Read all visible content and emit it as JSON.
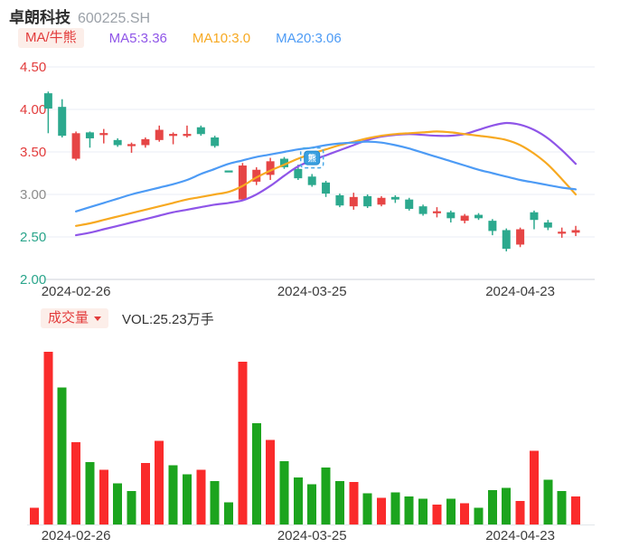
{
  "header": {
    "title": "卓朗科技",
    "code": "600225.SH"
  },
  "legend": {
    "toggle": "MA/牛熊",
    "ma5": "MA5:3.36",
    "ma10": "MA10:3.0",
    "ma20": "MA20:3.06"
  },
  "volume_header": {
    "selector": "成交量",
    "value": "VOL:25.23万手"
  },
  "colors": {
    "up": "#e64545",
    "down": "#2ca98e",
    "vol_up": "#fa2b2b",
    "vol_down": "#1ca41e",
    "ma5": "#8f55e8",
    "ma10": "#f7a921",
    "ma20": "#4d9bf5",
    "accent_red": "#e23b3b",
    "axis_label": "#3b3b3b",
    "grid": "#e9eef4",
    "axis_line": "#ccd2d9",
    "marker_fill": "#3ba0e0",
    "marker_border": "#2288cc",
    "marker_dash": "#4aa9e8"
  },
  "chart_data": [
    {
      "type": "candlestick",
      "title": "卓朗科技 600225.SH 日K",
      "y_ticks": [
        {
          "label": "4.50",
          "value": 4.5,
          "color": "#e23b3b"
        },
        {
          "label": "4.00",
          "value": 4.0,
          "color": "#e23b3b"
        },
        {
          "label": "3.50",
          "value": 3.5,
          "color": "#e23b3b"
        },
        {
          "label": "3.00",
          "value": 3.0,
          "color": "#8c8c8c"
        },
        {
          "label": "2.50",
          "value": 2.5,
          "color": "#2aa58b"
        },
        {
          "label": "2.00",
          "value": 2.0,
          "color": "#2aa58b"
        }
      ],
      "x_ticks": [
        {
          "day": 3,
          "label": "2024-02-26"
        },
        {
          "day": 20,
          "label": "2024-03-25"
        },
        {
          "day": 35,
          "label": "2024-04-23"
        }
      ],
      "ylim": [
        1.95,
        4.6
      ],
      "candles_note": "each entry: [day, open, close, high, low, dir(u=red up, d=green down)]",
      "candles": [
        [
          1,
          4.19,
          4.01,
          4.21,
          3.72,
          "d"
        ],
        [
          2,
          4.03,
          3.69,
          4.12,
          3.67,
          "d"
        ],
        [
          3,
          3.42,
          3.72,
          3.74,
          3.4,
          "u"
        ],
        [
          4,
          3.73,
          3.66,
          3.74,
          3.55,
          "d"
        ],
        [
          5,
          3.7,
          3.72,
          3.77,
          3.6,
          "u"
        ],
        [
          6,
          3.64,
          3.58,
          3.66,
          3.56,
          "d"
        ],
        [
          7,
          3.57,
          3.59,
          3.61,
          3.49,
          "u"
        ],
        [
          8,
          3.58,
          3.65,
          3.67,
          3.55,
          "u"
        ],
        [
          9,
          3.64,
          3.76,
          3.81,
          3.62,
          "u"
        ],
        [
          10,
          3.69,
          3.71,
          3.73,
          3.59,
          "u"
        ],
        [
          11,
          3.69,
          3.71,
          3.81,
          3.67,
          "u"
        ],
        [
          12,
          3.79,
          3.71,
          3.81,
          3.69,
          "d"
        ],
        [
          13,
          3.67,
          3.57,
          3.69,
          3.55,
          "d"
        ],
        [
          14,
          3.27,
          3.27,
          3.27,
          3.27,
          "d"
        ],
        [
          15,
          2.94,
          3.34,
          3.37,
          2.93,
          "u"
        ],
        [
          16,
          3.15,
          3.29,
          3.32,
          3.11,
          "u"
        ],
        [
          17,
          3.23,
          3.39,
          3.43,
          3.17,
          "u"
        ],
        [
          18,
          3.42,
          3.32,
          3.44,
          3.3,
          "d"
        ],
        [
          19,
          3.3,
          3.19,
          3.35,
          3.17,
          "d"
        ],
        [
          20,
          3.21,
          3.11,
          3.24,
          3.09,
          "d"
        ],
        [
          21,
          3.14,
          3.01,
          3.16,
          2.97,
          "d"
        ],
        [
          22,
          2.99,
          2.87,
          3.01,
          2.85,
          "d"
        ],
        [
          23,
          2.86,
          2.97,
          3.02,
          2.82,
          "u"
        ],
        [
          24,
          2.98,
          2.86,
          3.0,
          2.84,
          "d"
        ],
        [
          25,
          2.88,
          2.96,
          2.98,
          2.86,
          "u"
        ],
        [
          26,
          2.97,
          2.94,
          2.99,
          2.9,
          "d"
        ],
        [
          27,
          2.94,
          2.83,
          2.96,
          2.81,
          "d"
        ],
        [
          28,
          2.86,
          2.77,
          2.88,
          2.75,
          "d"
        ],
        [
          29,
          2.78,
          2.8,
          2.85,
          2.73,
          "u"
        ],
        [
          30,
          2.79,
          2.72,
          2.81,
          2.67,
          "d"
        ],
        [
          31,
          2.69,
          2.75,
          2.77,
          2.66,
          "u"
        ],
        [
          32,
          2.76,
          2.72,
          2.78,
          2.7,
          "d"
        ],
        [
          33,
          2.69,
          2.57,
          2.71,
          2.52,
          "d"
        ],
        [
          34,
          2.58,
          2.36,
          2.6,
          2.33,
          "d"
        ],
        [
          35,
          2.41,
          2.59,
          2.61,
          2.38,
          "u"
        ],
        [
          36,
          2.79,
          2.7,
          2.81,
          2.59,
          "d"
        ],
        [
          37,
          2.67,
          2.61,
          2.7,
          2.58,
          "d"
        ],
        [
          38,
          2.54,
          2.56,
          2.61,
          2.49,
          "u"
        ],
        [
          39,
          2.55,
          2.58,
          2.63,
          2.51,
          "u"
        ]
      ],
      "series": [
        {
          "name": "MA5",
          "color_key": "ma5",
          "latest": 3.36,
          "start_day": 3,
          "values": [
            2.52,
            2.55,
            2.59,
            2.63,
            2.67,
            2.71,
            2.75,
            2.79,
            2.82,
            2.85,
            2.88,
            2.9,
            2.93,
            3.0,
            3.1,
            3.22,
            3.33,
            3.4,
            3.46,
            3.52,
            3.58,
            3.64,
            3.68,
            3.7,
            3.71,
            3.7,
            3.69,
            3.69,
            3.71,
            3.76,
            3.81,
            3.84,
            3.82,
            3.76,
            3.66,
            3.52,
            3.36
          ]
        },
        {
          "name": "MA10",
          "color_key": "ma10",
          "latest": 3.0,
          "start_day": 3,
          "values": [
            2.63,
            2.66,
            2.7,
            2.74,
            2.78,
            2.82,
            2.86,
            2.9,
            2.94,
            2.97,
            3.0,
            3.03,
            3.1,
            3.2,
            3.28,
            3.35,
            3.42,
            3.48,
            3.53,
            3.58,
            3.62,
            3.66,
            3.69,
            3.71,
            3.72,
            3.73,
            3.74,
            3.73,
            3.71,
            3.69,
            3.67,
            3.64,
            3.58,
            3.48,
            3.35,
            3.18,
            3.0
          ]
        },
        {
          "name": "MA20",
          "color_key": "ma20",
          "latest": 3.06,
          "start_day": 3,
          "values": [
            2.8,
            2.85,
            2.9,
            2.95,
            3.0,
            3.04,
            3.08,
            3.12,
            3.17,
            3.24,
            3.3,
            3.36,
            3.4,
            3.44,
            3.47,
            3.5,
            3.53,
            3.55,
            3.58,
            3.6,
            3.61,
            3.62,
            3.61,
            3.58,
            3.54,
            3.49,
            3.44,
            3.39,
            3.34,
            3.29,
            3.25,
            3.21,
            3.17,
            3.14,
            3.11,
            3.08,
            3.06
          ]
        }
      ],
      "marker": {
        "day": 20,
        "price": 3.43,
        "glyph": "熊"
      }
    },
    {
      "type": "bar",
      "title": "成交量",
      "unit": "万手",
      "latest_label": "VOL:25.23万手",
      "x_ticks": [
        {
          "day": 3,
          "label": "2024-02-26"
        },
        {
          "day": 20,
          "label": "2024-03-25"
        },
        {
          "day": 35,
          "label": "2024-04-23"
        }
      ],
      "bars_note": "each entry: [day, volume(万手), dir(u=red, d=green)]",
      "bars": [
        [
          0,
          15,
          "u"
        ],
        [
          1,
          155,
          "u"
        ],
        [
          2,
          123,
          "d"
        ],
        [
          3,
          74,
          "u"
        ],
        [
          4,
          56,
          "d"
        ],
        [
          5,
          49,
          "u"
        ],
        [
          6,
          37,
          "d"
        ],
        [
          7,
          30,
          "d"
        ],
        [
          8,
          55,
          "u"
        ],
        [
          9,
          75,
          "u"
        ],
        [
          10,
          53,
          "d"
        ],
        [
          11,
          45,
          "d"
        ],
        [
          12,
          49,
          "u"
        ],
        [
          13,
          39,
          "d"
        ],
        [
          14,
          20,
          "d"
        ],
        [
          15,
          146,
          "u"
        ],
        [
          16,
          91,
          "d"
        ],
        [
          17,
          76,
          "u"
        ],
        [
          18,
          57,
          "d"
        ],
        [
          19,
          42,
          "d"
        ],
        [
          20,
          36,
          "d"
        ],
        [
          21,
          51,
          "d"
        ],
        [
          22,
          39,
          "d"
        ],
        [
          23,
          38,
          "u"
        ],
        [
          24,
          28,
          "d"
        ],
        [
          25,
          24,
          "u"
        ],
        [
          26,
          29,
          "d"
        ],
        [
          27,
          25,
          "d"
        ],
        [
          28,
          23,
          "d"
        ],
        [
          29,
          18,
          "u"
        ],
        [
          30,
          23,
          "d"
        ],
        [
          31,
          19,
          "u"
        ],
        [
          32,
          15,
          "d"
        ],
        [
          33,
          31,
          "d"
        ],
        [
          34,
          33,
          "d"
        ],
        [
          35,
          21,
          "u"
        ],
        [
          36,
          66,
          "u"
        ],
        [
          37,
          40,
          "d"
        ],
        [
          38,
          30,
          "d"
        ],
        [
          39,
          25.23,
          "u"
        ]
      ]
    }
  ]
}
